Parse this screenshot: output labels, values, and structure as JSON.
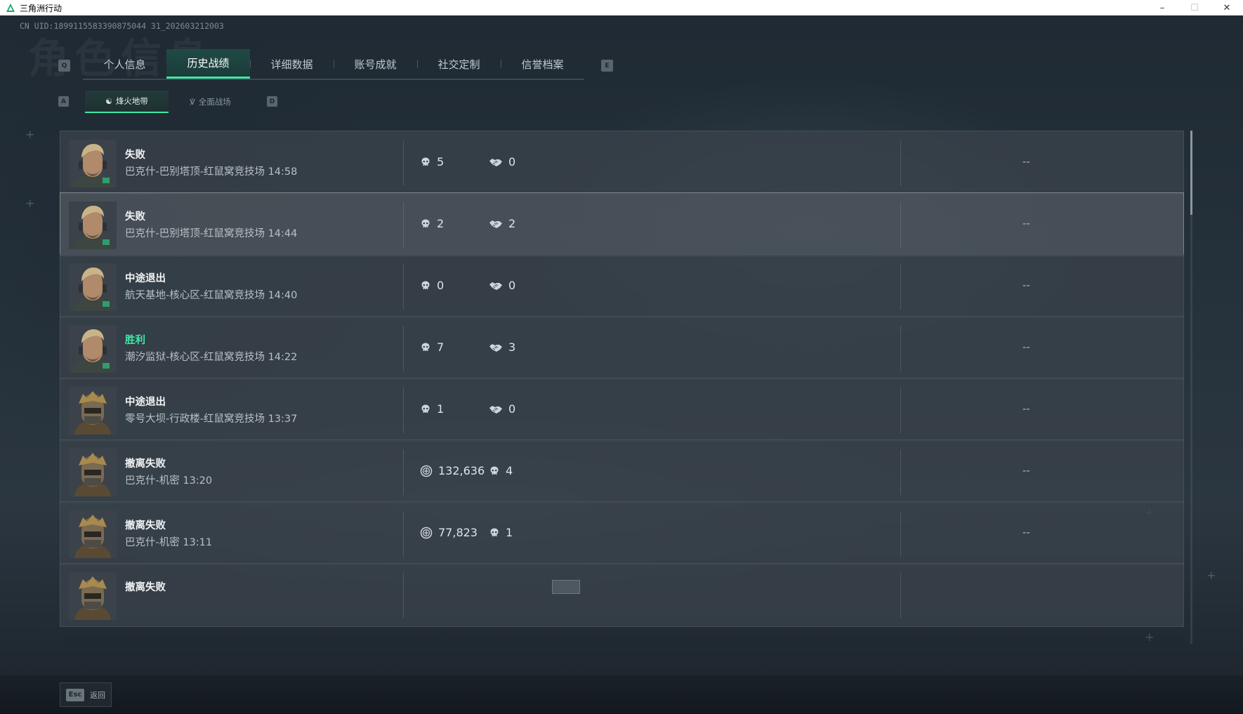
{
  "window": {
    "title": "三角洲行动"
  },
  "uid": "CN UID:1899115583390875044 31_202603212003",
  "watermark": "角色信息",
  "main_tabs": {
    "left_key": "Q",
    "right_key": "E",
    "items": [
      {
        "label": "个人信息",
        "active": false
      },
      {
        "label": "历史战绩",
        "active": true
      },
      {
        "label": "详细数据",
        "active": false
      },
      {
        "label": "账号成就",
        "active": false
      },
      {
        "label": "社交定制",
        "active": false
      },
      {
        "label": "信誉档案",
        "active": false
      }
    ]
  },
  "sub_tabs": {
    "left_key": "A",
    "right_key": "D",
    "items": [
      {
        "label": "烽火地带",
        "active": true
      },
      {
        "label": "全面战场",
        "active": false
      }
    ]
  },
  "records": [
    {
      "result": "失败",
      "map": "巴克什-巴别塔顶-红鼠窝竞技场 14:58",
      "avatar": "operator-male",
      "stats": [
        {
          "icon": "skull-icon",
          "value": "5"
        },
        {
          "icon": "handshake-icon",
          "value": "0"
        }
      ],
      "extra": "--",
      "highlight": false,
      "win": false
    },
    {
      "result": "失败",
      "map": "巴克什-巴别塔顶-红鼠窝竞技场 14:44",
      "avatar": "operator-male",
      "stats": [
        {
          "icon": "skull-icon",
          "value": "2"
        },
        {
          "icon": "handshake-icon",
          "value": "2"
        }
      ],
      "extra": "--",
      "highlight": true,
      "win": false
    },
    {
      "result": "中途退出",
      "map": "航天基地-核心区-红鼠窝竞技场 14:40",
      "avatar": "operator-male",
      "stats": [
        {
          "icon": "skull-icon",
          "value": "0"
        },
        {
          "icon": "handshake-icon",
          "value": "0"
        }
      ],
      "extra": "--",
      "highlight": false,
      "win": false
    },
    {
      "result": "胜利",
      "map": "潮汐监狱-核心区-红鼠窝竞技场 14:22",
      "avatar": "operator-male",
      "stats": [
        {
          "icon": "skull-icon",
          "value": "7"
        },
        {
          "icon": "handshake-icon",
          "value": "3"
        }
      ],
      "extra": "--",
      "highlight": false,
      "win": true
    },
    {
      "result": "中途退出",
      "map": "零号大坝-行政楼-红鼠窝竞技场 13:37",
      "avatar": "operator-helmet",
      "stats": [
        {
          "icon": "skull-icon",
          "value": "1"
        },
        {
          "icon": "handshake-icon",
          "value": "0"
        }
      ],
      "extra": "--",
      "highlight": false,
      "win": false
    },
    {
      "result": "撤离失败",
      "map": "巴克什-机密 13:20",
      "avatar": "operator-helmet",
      "stats": [
        {
          "icon": "coin-icon",
          "value": "132,636"
        },
        {
          "icon": "skull-icon",
          "value": "4"
        }
      ],
      "extra": "--",
      "highlight": false,
      "win": false
    },
    {
      "result": "撤离失败",
      "map": "巴克什-机密 13:11",
      "avatar": "operator-helmet",
      "stats": [
        {
          "icon": "coin-icon",
          "value": "77,823"
        },
        {
          "icon": "skull-icon",
          "value": "1"
        }
      ],
      "extra": "--",
      "highlight": false,
      "win": false
    },
    {
      "result": "撤离失败",
      "map": "",
      "avatar": "operator-helmet",
      "stats": [],
      "extra": "",
      "highlight": false,
      "win": false
    }
  ],
  "footer": {
    "esc_key": "Esc",
    "esc_label": "返回"
  }
}
